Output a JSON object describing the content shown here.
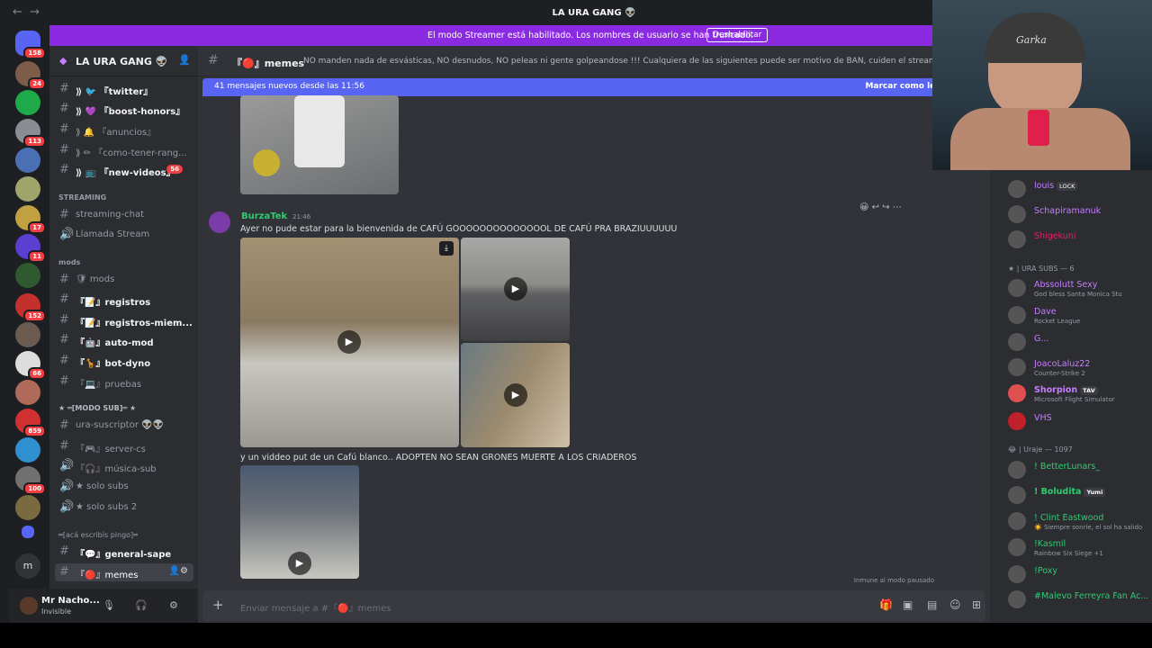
{
  "window": {
    "title": "LA URA GANG 👽"
  },
  "banner": {
    "text": "El modo Streamer está habilitado. Los nombres de usuario se han truncado.",
    "button": "Deshabilitar"
  },
  "servers": {
    "home_badge": "158",
    "badges": [
      "24",
      "113",
      "17",
      "11",
      "152",
      "66",
      "859",
      "100"
    ],
    "collapsed_letter": "m"
  },
  "guild": {
    "name": "LA URA GANG 👽"
  },
  "channels": {
    "top": [
      {
        "label": "⟫ 🐦 『twitter』",
        "bold": true
      },
      {
        "label": "⟫ 💜 『boost-honors』",
        "bold": true
      },
      {
        "label": "⟫ 🔔 『anuncios』",
        "bold": false
      },
      {
        "label": "⟫ ✏ 『como-tener-rang...",
        "bold": false
      },
      {
        "label": "⟫ 📺 『new-videos』",
        "bold": true,
        "count": "56"
      }
    ],
    "streaming_cat": "STREAMING",
    "streaming": [
      {
        "label": "streaming-chat"
      },
      {
        "label": "Llamada Stream"
      }
    ],
    "mods_cat": "mods",
    "mods": [
      {
        "label": "🛡 mods",
        "bold": false
      },
      {
        "label": "『📝』registros",
        "bold": true
      },
      {
        "label": "『📝』registros-miem...",
        "bold": true
      },
      {
        "label": "『🤖』auto-mod",
        "bold": true
      },
      {
        "label": "『🦒』bot-dyno",
        "bold": true
      },
      {
        "label": "『💻』pruebas",
        "bold": false
      }
    ],
    "sub_cat": "★ ═[MODO SUB]═ ★",
    "sub": [
      {
        "label": "ura-suscriptor 👽👽"
      },
      {
        "label": "『🎮』server-cs"
      },
      {
        "label": "『🎧』música-sub"
      },
      {
        "label": "★ solo subs"
      },
      {
        "label": "★ solo subs 2"
      }
    ],
    "chat_cat": "═[acá escribís pingo]═",
    "chat": [
      {
        "label": "『💬』general-sape",
        "bold": true
      },
      {
        "label": "『🔴』memes",
        "active": true
      }
    ]
  },
  "user": {
    "name": "Mr Nacho...",
    "status": "Invisible"
  },
  "channel": {
    "name": "『🔴』memes",
    "topic": "NO manden nada de esvásticas, NO desnudos, NO peleas ni gente golpeandose !!! Cualquiera de las siguientes puede ser motivo de BAN, cuiden el stream!"
  },
  "new_messages": {
    "text": "41 mensajes nuevos desde las 11:56",
    "mark": "Marcar como leído"
  },
  "message": {
    "author": "BurzaTek",
    "time": "21:46",
    "line1": "Ayer no pude estar para la bienvenida de CAFÚ GOOOOOOOOOOOOOOL DE CAFÚ PRA BRAZIUUUUUU",
    "line2": "y un viddeo put de un Cafú blanco.. ADOPTEN NO SEAN GRONES MUERTE A LOS CRIADEROS"
  },
  "composer": {
    "placeholder": "Enviar mensaje a #『🔴』memes"
  },
  "immune": "Inmune al modo pausado",
  "members": {
    "online": [
      {
        "name": "louis",
        "tag": "LOCK",
        "color": "#c77dff"
      },
      {
        "name": "Schapiramanuk",
        "color": "#c77dff"
      },
      {
        "name": "Shigekuni",
        "color": "#e91e63"
      }
    ],
    "subs_cat": "★ | URA SUBS — 6",
    "subs": [
      {
        "name": "Abssolutt Sexy",
        "status": "God bless Santa Monica Stu",
        "color": "#c77dff"
      },
      {
        "name": "Dave",
        "status": "Rocket League",
        "color": "#c77dff"
      },
      {
        "name": "G...",
        "status": "",
        "color": "#c77dff"
      },
      {
        "name": "JoacoLaluz22",
        "status": "Counter-Strike 2",
        "color": "#c77dff"
      },
      {
        "name": "Shorpion",
        "tag": "TAV",
        "status": "Microsoft Flight Simulator",
        "color": "#c77dff"
      },
      {
        "name": "VHS",
        "status": "",
        "color": "#c77dff"
      }
    ],
    "uraje_cat": "😂 | Uraje — 1097",
    "uraje": [
      {
        "name": "! BetterLunars_",
        "status": "",
        "color": "#2ecc71"
      },
      {
        "name": "! Boludita",
        "tag": "Yumi",
        "status": "",
        "color": "#2ecc71"
      },
      {
        "name": "! Clint Eastwood",
        "status": "☀️ Siempre sonríe, el sol ha salido",
        "color": "#2ecc71"
      },
      {
        "name": "!Kasmil",
        "status": "Rainbow Six Siege +1",
        "color": "#2ecc71"
      },
      {
        "name": "!Poxy",
        "status": "",
        "color": "#2ecc71"
      },
      {
        "name": "#Malevo Ferreyra Fan Ac...",
        "status": "",
        "color": "#2ecc71"
      }
    ]
  },
  "webcam": {
    "cap_text": "Garka"
  }
}
